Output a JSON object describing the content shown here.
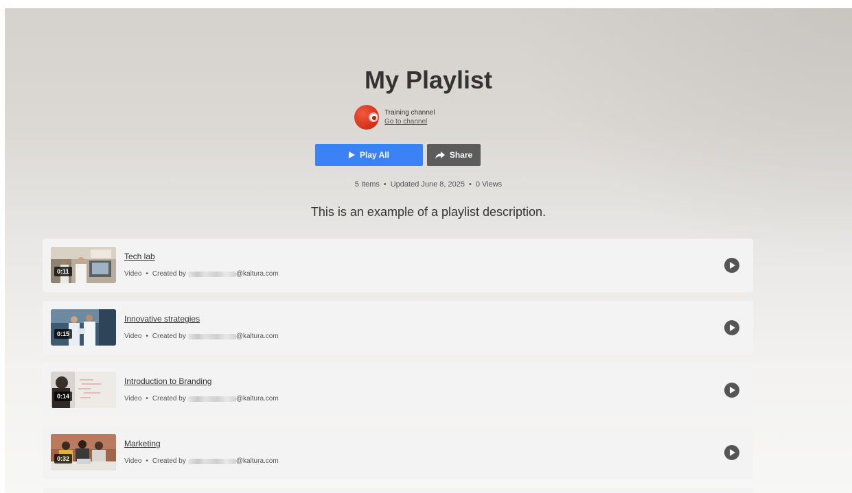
{
  "playlist": {
    "title": "My Playlist",
    "description": "This is an example of a playlist description."
  },
  "channel": {
    "name": "Training channel",
    "link_label": "Go to channel"
  },
  "actions": {
    "play_all_label": "Play All",
    "share_label": "Share"
  },
  "stats": {
    "items": "5 Items",
    "updated": "Updated June 8, 2025",
    "views": "0 Views",
    "separator": "•"
  },
  "entries": [
    {
      "title": "Tech lab",
      "duration": "0:11",
      "type": "Video",
      "created_by": "Created by",
      "email_suffix": "@kaltura.com"
    },
    {
      "title": "Innovative strategies",
      "duration": "0:15",
      "type": "Video",
      "created_by": "Created by",
      "email_suffix": "@kaltura.com"
    },
    {
      "title": "Introduction to Branding",
      "duration": "0:14",
      "type": "Video",
      "created_by": "Created by",
      "email_suffix": "@kaltura.com"
    },
    {
      "title": "Marketing",
      "duration": "0:32",
      "type": "Video",
      "created_by": "Created by",
      "email_suffix": "@kaltura.com"
    }
  ],
  "colors": {
    "primary_button": "#3b82f6",
    "share_button": "#5c5c5c",
    "text": "#333333",
    "avatar": "#d8341c"
  }
}
